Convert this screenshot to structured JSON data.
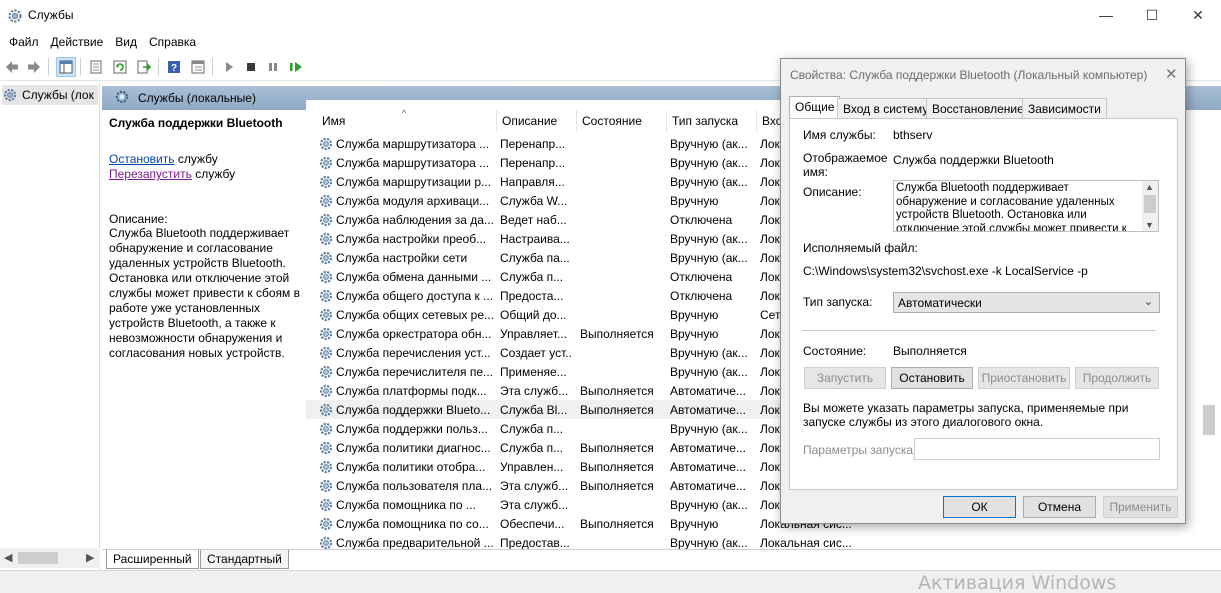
{
  "window": {
    "title": "Службы",
    "controls": {
      "minimize": "—",
      "maximize": "☐",
      "close": "✕"
    }
  },
  "menu": [
    "Файл",
    "Действие",
    "Вид",
    "Справка"
  ],
  "tree": {
    "node_label": "Службы (лок"
  },
  "pane": {
    "header": "Службы (локальные)",
    "detail": {
      "service_name": "Служба поддержки Bluetooth",
      "stop_link": "Остановить",
      "stop_suffix": " службу",
      "restart_link": "Перезапустить",
      "restart_suffix": " службу",
      "description_label": "Описание:",
      "description": "Служба Bluetooth поддерживает обнаружение и согласование удаленных устройств Bluetooth. Остановка или отключение этой службы может привести к сбоям в работе уже установленных устройств Bluetooth, а также к невозможности обнаружения и согласования новых устройств."
    },
    "columns": [
      "Имя",
      "Описание",
      "Состояние",
      "Тип запуска",
      "Вхо"
    ],
    "rows": [
      {
        "name": "Служба маршрутизатора ...",
        "desc": "Перенапр...",
        "state": "",
        "startup": "Вручную (ак...",
        "logon": "Лок"
      },
      {
        "name": "Служба маршрутизатора ...",
        "desc": "Перенапр...",
        "state": "",
        "startup": "Вручную (ак...",
        "logon": "Лок"
      },
      {
        "name": "Служба маршрутизации р...",
        "desc": "Направля...",
        "state": "",
        "startup": "Вручную (ак...",
        "logon": "Лок"
      },
      {
        "name": "Служба модуля архиваци...",
        "desc": "Служба W...",
        "state": "",
        "startup": "Вручную",
        "logon": "Лок"
      },
      {
        "name": "Служба наблюдения за да...",
        "desc": "Ведет наб...",
        "state": "",
        "startup": "Отключена",
        "logon": "Лок"
      },
      {
        "name": "Служба настройки преоб...",
        "desc": "Настраива...",
        "state": "",
        "startup": "Вручную (ак...",
        "logon": "Лок"
      },
      {
        "name": "Служба настройки сети",
        "desc": "Служба па...",
        "state": "",
        "startup": "Вручную (ак...",
        "logon": "Лок"
      },
      {
        "name": "Служба обмена данными ...",
        "desc": "Служба п...",
        "state": "",
        "startup": "Отключена",
        "logon": "Лок"
      },
      {
        "name": "Служба общего доступа к ...",
        "desc": "Предоста...",
        "state": "",
        "startup": "Отключена",
        "logon": "Лок"
      },
      {
        "name": "Служба общих сетевых ре...",
        "desc": "Общий до...",
        "state": "",
        "startup": "Вручную",
        "logon": "Сет"
      },
      {
        "name": "Служба оркестратора обн...",
        "desc": "Управляет...",
        "state": "Выполняется",
        "startup": "Вручную",
        "logon": "Лок"
      },
      {
        "name": "Служба перечисления уст...",
        "desc": "Создает уст...",
        "state": "",
        "startup": "Вручную (ак...",
        "logon": "Лок"
      },
      {
        "name": "Служба перечислителя пе...",
        "desc": "Применяе...",
        "state": "",
        "startup": "Вручную (ак...",
        "logon": "Лок"
      },
      {
        "name": "Служба платформы подк...",
        "desc": "Эта служб...",
        "state": "Выполняется",
        "startup": "Автоматиче...",
        "logon": "Лок"
      },
      {
        "name": "Служба поддержки Blueto...",
        "desc": "Служба Bl...",
        "state": "Выполняется",
        "startup": "Автоматиче...",
        "logon": "Лок"
      },
      {
        "name": "Служба поддержки польз...",
        "desc": "Служба п...",
        "state": "",
        "startup": "Вручную (ак...",
        "logon": "Лок"
      },
      {
        "name": "Служба политики диагнос...",
        "desc": "Служба п...",
        "state": "Выполняется",
        "startup": "Автоматиче...",
        "logon": "Лок"
      },
      {
        "name": "Служба политики отобра...",
        "desc": "Управлен...",
        "state": "Выполняется",
        "startup": "Автоматиче...",
        "logon": "Лок"
      },
      {
        "name": "Служба пользователя пла...",
        "desc": "Эта служб...",
        "state": "Выполняется",
        "startup": "Автоматиче...",
        "logon": "Лок"
      },
      {
        "name": "Служба помощника по ...",
        "desc": "Эта служб...",
        "state": "",
        "startup": "Вручную (ак...",
        "logon": "Лок"
      },
      {
        "name": "Служба помощника по со...",
        "desc": "Обеспечи...",
        "state": "Выполняется",
        "startup": "Вручную",
        "logon": "Локальная сис..."
      },
      {
        "name": "Служба предварительной ...",
        "desc": "Предостав...",
        "state": "",
        "startup": "Вручную (ак...",
        "logon": "Локальная сис..."
      }
    ],
    "selected_row_index": 14,
    "tabs": [
      "Расширенный",
      "Стандартный"
    ]
  },
  "dialog": {
    "title": "Свойства: Служба поддержки Bluetooth (Локальный компьютер)",
    "tabs": [
      "Общие",
      "Вход в систему",
      "Восстановление",
      "Зависимости"
    ],
    "service_name_label": "Имя службы:",
    "service_name": "bthserv",
    "display_name_label": "Отображаемое имя:",
    "display_name": "Служба поддержки Bluetooth",
    "description_label": "Описание:",
    "description": "Служба Bluetooth поддерживает обнаружение и согласование удаленных устройств Bluetooth. Остановка или отключение этой службы может привести к сбоям в работе уже установленных",
    "exec_label": "Исполняемый файл:",
    "exec_path": "C:\\Windows\\system32\\svchost.exe -k LocalService -p",
    "startup_type_label": "Тип запуска:",
    "startup_type": "Автоматически",
    "status_label": "Состояние:",
    "status": "Выполняется",
    "buttons": {
      "start": "Запустить",
      "stop": "Остановить",
      "pause": "Приостановить",
      "resume": "Продолжить"
    },
    "hint": "Вы можете указать параметры запуска, применяемые при запуске службы из этого диалогового окна.",
    "params_label": "Параметры запуска:",
    "params_value": "",
    "ok": "ОК",
    "cancel": "Отмена",
    "apply": "Применить"
  },
  "watermark": "Активация Windows",
  "colors": {
    "header_band": "#9cb4ce",
    "link_stop": "#0645ad",
    "link_restart": "#7a1d8c",
    "selection": "#f0f0f0"
  }
}
